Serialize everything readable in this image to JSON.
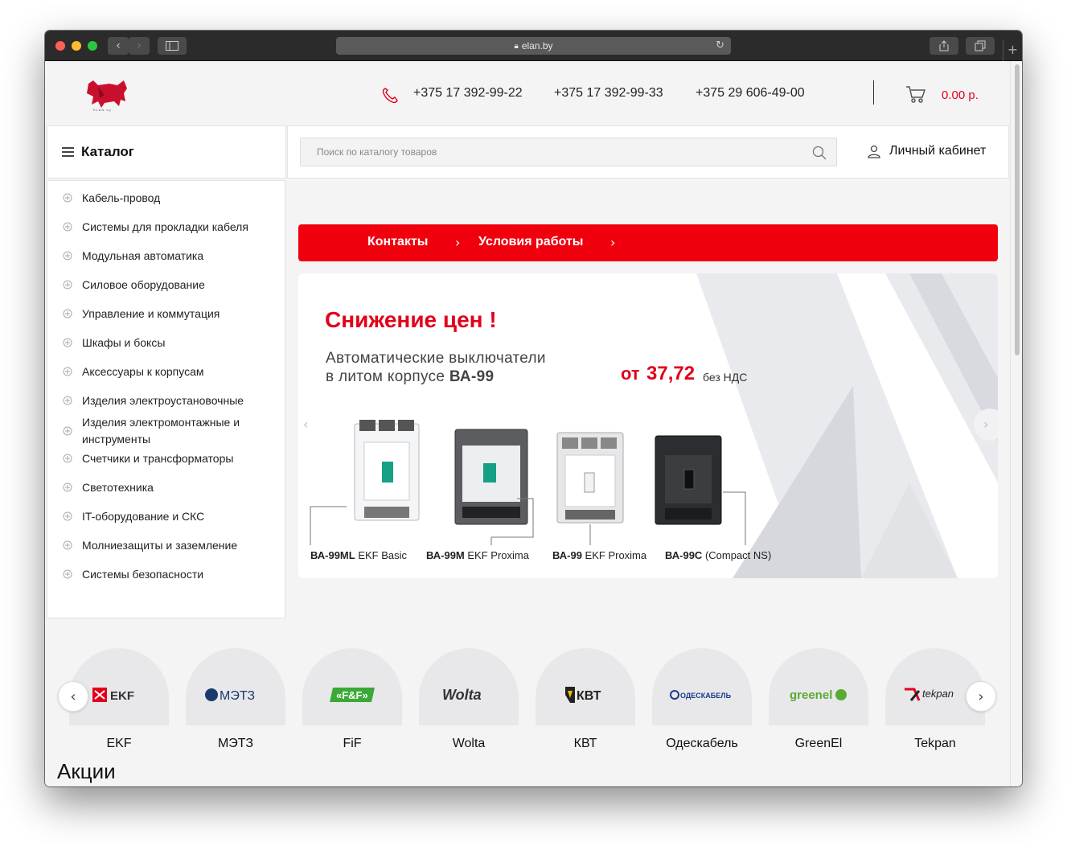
{
  "browser": {
    "url": "elan.by",
    "lock_icon": "lock-icon",
    "reload_icon": "reload-icon"
  },
  "header": {
    "phones": [
      "+375 17 392-99-22",
      "+375 17 392-99-33",
      "+375 29 606-49-00"
    ],
    "cart_total": "0.00 р.",
    "accent_color": "#e2001a"
  },
  "catalog": {
    "title": "Каталог",
    "items": [
      "Кабель-провод",
      "Системы для прокладки кабеля",
      "Модульная автоматика",
      "Силовое оборудование",
      "Управление и коммутация",
      "Шкафы и боксы",
      "Аксессуары к корпусам",
      "Изделия электроустановочные",
      "Изделия электромонтажные и инструменты",
      "Счетчики и трансформаторы",
      "Светотехника",
      "IT-оборудование и СКС",
      "Молниезащиты и заземление",
      "Системы безопасности"
    ]
  },
  "search": {
    "placeholder": "Поиск по каталогу товаров"
  },
  "account": {
    "label": "Личный кабинет"
  },
  "nav": {
    "links": [
      "Контакты",
      "Условия работы"
    ],
    "bar_color": "#f0000c"
  },
  "banner": {
    "title": "Снижение цен !",
    "subtitle_line1": "Автоматические выключатели",
    "subtitle_line2_prefix": "в литом корпусе ",
    "subtitle_line2_bold": "ВА-99",
    "price_from": "от",
    "price_value": "37,72",
    "price_vat": "без НДС",
    "products": [
      {
        "model": "ВА-99ML",
        "series": "EKF Basic"
      },
      {
        "model": "ВА-99М",
        "series": "EKF Proxima"
      },
      {
        "model": "ВА-99",
        "series": "EKF Proxima"
      },
      {
        "model": "ВА-99С",
        "series": "(Compact NS)"
      }
    ]
  },
  "brands": {
    "items": [
      {
        "name": "EKF",
        "logo_text": "EKF"
      },
      {
        "name": "МЭТЗ",
        "logo_text": "МЭТЗ"
      },
      {
        "name": "FiF",
        "logo_text": "«F&F»"
      },
      {
        "name": "Wolta",
        "logo_text": "Wolta"
      },
      {
        "name": "КВТ",
        "logo_text": "КВТ"
      },
      {
        "name": "Одескабель",
        "logo_text": "ОДЕСКАБЕЛЬ"
      },
      {
        "name": "GreenEl",
        "logo_text": "greenel"
      },
      {
        "name": "Tekpan",
        "logo_text": "tekpan"
      }
    ]
  },
  "sections": {
    "promotions_title": "Акции"
  }
}
